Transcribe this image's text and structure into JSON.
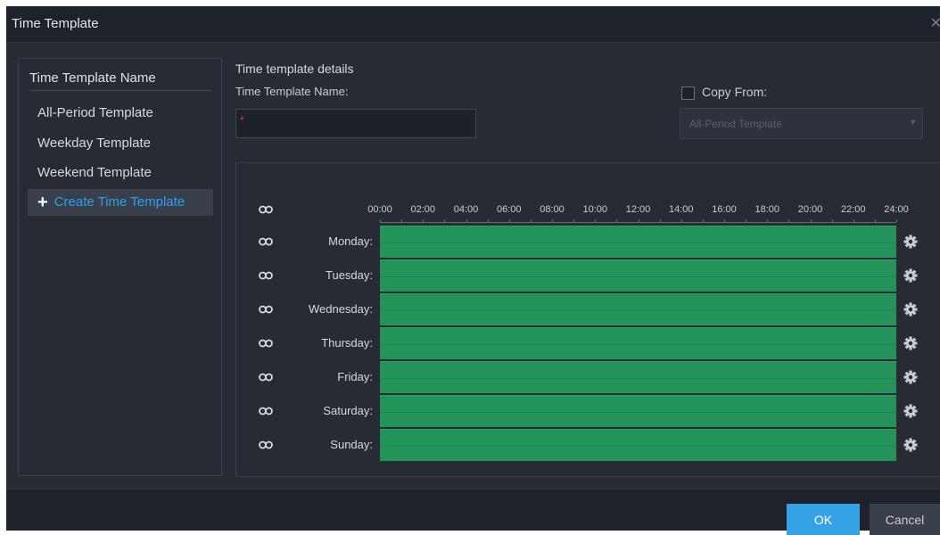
{
  "dialog": {
    "title": "Time Template",
    "close_icon": "close-icon"
  },
  "sidebar": {
    "header": "Time Template Name",
    "items": [
      {
        "label": "All-Period Template"
      },
      {
        "label": "Weekday Template"
      },
      {
        "label": "Weekend Template"
      }
    ],
    "create_label": "Create Time Template",
    "create_icon": "plus-icon"
  },
  "details": {
    "title": "Time template details",
    "name_label": "Time Template Name:",
    "name_value": "",
    "required_mark": "*",
    "copy_from_label": "Copy From:",
    "copy_from_checked": false,
    "copy_from_value": "All-Period Template"
  },
  "schedule": {
    "hour_labels": [
      "00:00",
      "02:00",
      "04:00",
      "06:00",
      "08:00",
      "10:00",
      "12:00",
      "14:00",
      "16:00",
      "18:00",
      "20:00",
      "22:00",
      "24:00"
    ],
    "days": [
      {
        "label": "Monday:",
        "start": "00:00",
        "end": "24:00"
      },
      {
        "label": "Tuesday:",
        "start": "00:00",
        "end": "24:00"
      },
      {
        "label": "Wednesday:",
        "start": "00:00",
        "end": "24:00"
      },
      {
        "label": "Thursday:",
        "start": "00:00",
        "end": "24:00"
      },
      {
        "label": "Friday:",
        "start": "00:00",
        "end": "24:00"
      },
      {
        "label": "Saturday:",
        "start": "00:00",
        "end": "24:00"
      },
      {
        "label": "Sunday:",
        "start": "00:00",
        "end": "24:00"
      }
    ],
    "active_color": "#23935a"
  },
  "footer": {
    "ok_label": "OK",
    "cancel_label": "Cancel"
  },
  "colors": {
    "accent": "#35a2e6",
    "link": "#2c9ff0",
    "background": "#262b34"
  }
}
